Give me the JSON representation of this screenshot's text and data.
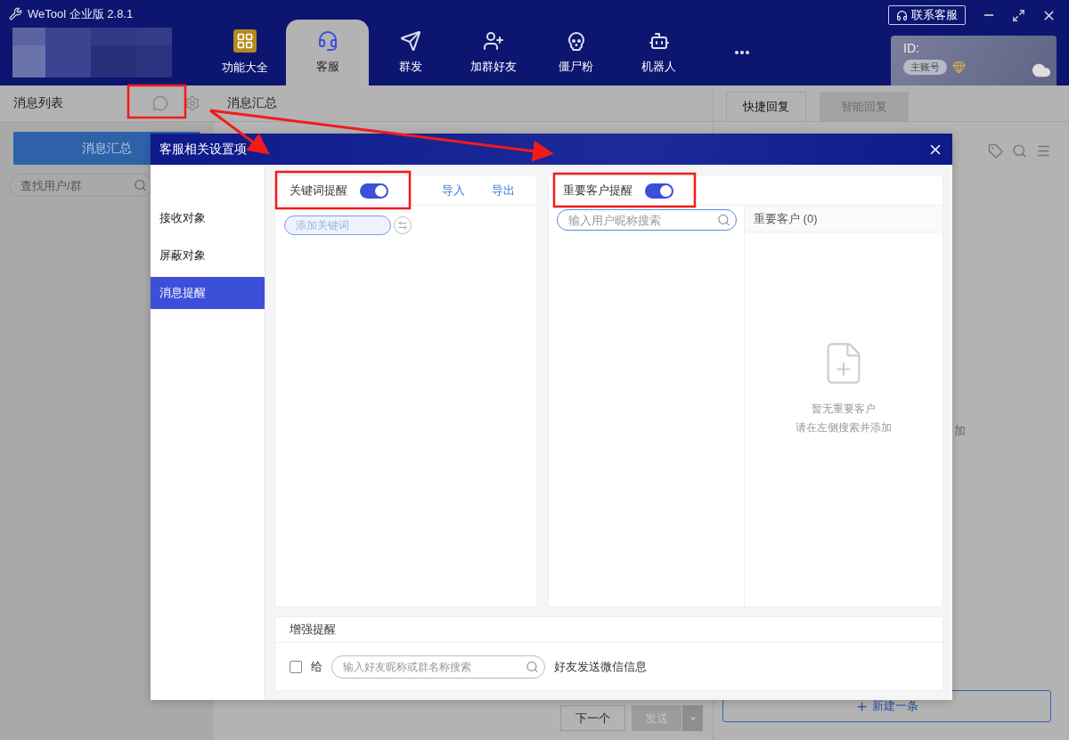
{
  "window": {
    "title": "WeTool 企业版 2.8.1",
    "contact_button": "联系客服"
  },
  "nav": [
    {
      "kind": "grid",
      "label": "功能大全",
      "selected": false
    },
    {
      "kind": "headset",
      "label": "客服",
      "selected": true
    },
    {
      "kind": "send",
      "label": "群发",
      "selected": false
    },
    {
      "kind": "user-plus",
      "label": "加群好友",
      "selected": false
    },
    {
      "kind": "skull",
      "label": "僵尸粉",
      "selected": false
    },
    {
      "kind": "robot",
      "label": "机器人",
      "selected": false
    },
    {
      "kind": "more",
      "selected": false
    }
  ],
  "account": {
    "id_label": "ID:",
    "badge": "主账号"
  },
  "left_panel": {
    "title": "消息列表",
    "summary_button": "消息汇总",
    "search_placeholder": "查找用户/群"
  },
  "middle": {
    "title": "消息汇总",
    "next_button": "下一个",
    "send": {
      "label": "发送",
      "disabled": true
    }
  },
  "right_panel": {
    "tabs": [
      {
        "label": "快捷回复",
        "selected": true
      },
      {
        "label": "智能回复",
        "selected": false
      }
    ],
    "hint": "加",
    "new_button": "新建一条"
  },
  "dialog": {
    "title": "客服相关设置项",
    "nav": [
      {
        "label": "接收对象",
        "selected": false
      },
      {
        "label": "屏蔽对象",
        "selected": false
      },
      {
        "label": "消息提醒",
        "selected": true
      }
    ],
    "keyword": {
      "label": "关键词提醒",
      "on": true,
      "import": "导入",
      "export": "导出",
      "placeholder": "添加关键词"
    },
    "vip": {
      "label": "重要客户提醒",
      "on": true,
      "search_placeholder": "输入用户昵称搜索",
      "list_title": "重要客户 (0)",
      "empty_lines": [
        "暂无重要客户",
        "请在左侧搜索并添加"
      ]
    },
    "enhanced": {
      "title": "增强提醒",
      "checked": false,
      "prefix": "给",
      "placeholder": "输入好友昵称或群名称搜索",
      "suffix": "好友发送微信信息"
    }
  }
}
